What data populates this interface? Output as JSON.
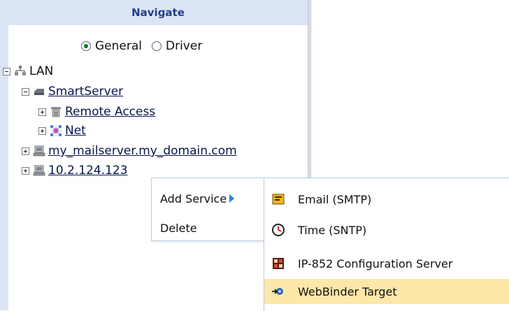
{
  "navigate": {
    "header": "Navigate",
    "radio_options": [
      {
        "label": "General",
        "checked": true
      },
      {
        "label": "Driver",
        "checked": false
      }
    ]
  },
  "tree": {
    "lan": "LAN",
    "smartserver": "SmartServer",
    "remote_access": "Remote Access",
    "net": "Net",
    "mailserver": "my_mailserver.my_domain.com",
    "ip_host": "10.2.124.123"
  },
  "context_menu": {
    "add_service": "Add Service",
    "delete": "Delete"
  },
  "submenu": {
    "items": [
      {
        "label": "Email (SMTP)",
        "icon": "email-icon"
      },
      {
        "label": "Time (SNTP)",
        "icon": "clock-icon"
      },
      {
        "label": "IP-852 Configuration Server",
        "icon": "server-icon"
      },
      {
        "label": "WebBinder Target",
        "icon": "target-icon"
      }
    ],
    "highlighted_item": "WebBinder Target"
  },
  "colors": {
    "header_bg": "#dce5f5",
    "header_text": "#1f3f8a",
    "highlight_bg": "#fde7a9",
    "link": "#07164f"
  }
}
